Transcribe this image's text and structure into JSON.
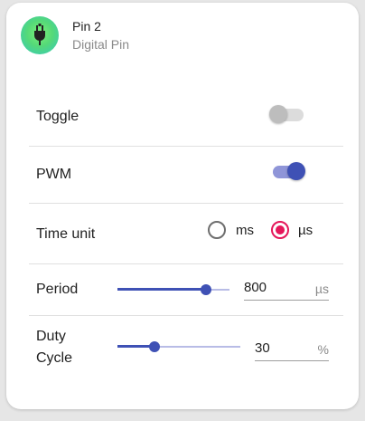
{
  "header": {
    "title": "Pin 2",
    "subtitle": "Digital Pin",
    "icon": "plug-icon"
  },
  "toggle_row": {
    "label": "Toggle",
    "state": "off"
  },
  "pwm_row": {
    "label": "PWM",
    "state": "on"
  },
  "time_unit_row": {
    "label": "Time unit",
    "options": [
      {
        "label": "ms",
        "selected": false
      },
      {
        "label": "µs",
        "selected": true
      }
    ]
  },
  "period_row": {
    "label": "Period",
    "value": "800",
    "unit": "µs",
    "slider_fraction": 0.79
  },
  "duty_row": {
    "label_line1": "Duty",
    "label_line2": "Cycle",
    "value": "30",
    "unit": "%",
    "slider_fraction": 0.3
  },
  "colors": {
    "accent": "#3f51b5",
    "radio_accent": "#e5175a"
  }
}
